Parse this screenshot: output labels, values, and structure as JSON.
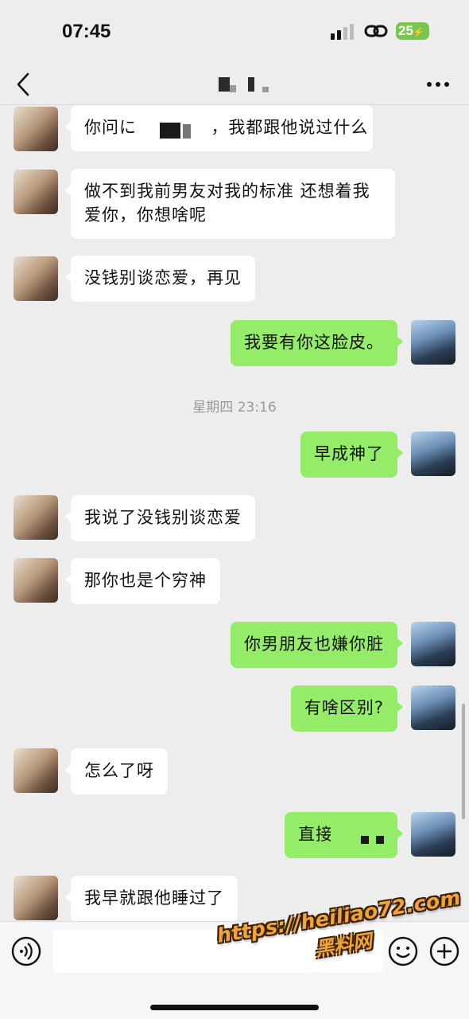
{
  "status_bar": {
    "time": "07:45",
    "battery_level": "25",
    "battery_color": "#7ac64d"
  },
  "nav": {
    "back_icon": "chevron-left-icon",
    "more_icon": "ellipsis-icon"
  },
  "messages": [
    {
      "side": "left",
      "text_before": "你问に",
      "text_after": "，我都跟他说过什么"
    },
    {
      "side": "left",
      "text": "做不到我前男友对我的标准 还想着我爱你，你想啥呢"
    },
    {
      "side": "left",
      "text": "没钱别谈恋爱，再见"
    },
    {
      "side": "right",
      "text": "我要有你这脸皮。"
    },
    {
      "side": "right",
      "text": "早成神了"
    },
    {
      "side": "left",
      "text": "我说了没钱别谈恋爱"
    },
    {
      "side": "left",
      "text": "那你也是个穷神"
    },
    {
      "side": "right",
      "text": "你男朋友也嫌你脏"
    },
    {
      "side": "right",
      "text": "有啥区别?"
    },
    {
      "side": "left",
      "text": "怎么了呀"
    },
    {
      "side": "right",
      "text": "直接"
    },
    {
      "side": "left",
      "text": "我早就跟他睡过了"
    }
  ],
  "timestamp": "星期四 23:16",
  "input_bar": {
    "placeholder": "",
    "voice_icon": "voice-icon",
    "emoji_icon": "emoji-icon",
    "plus_icon": "plus-icon"
  },
  "watermark": {
    "url": "https://heiliao72.com",
    "cn": "黑料网"
  },
  "colors": {
    "background": "#ededed",
    "my_bubble": "#95ec69",
    "their_bubble": "#ffffff"
  }
}
